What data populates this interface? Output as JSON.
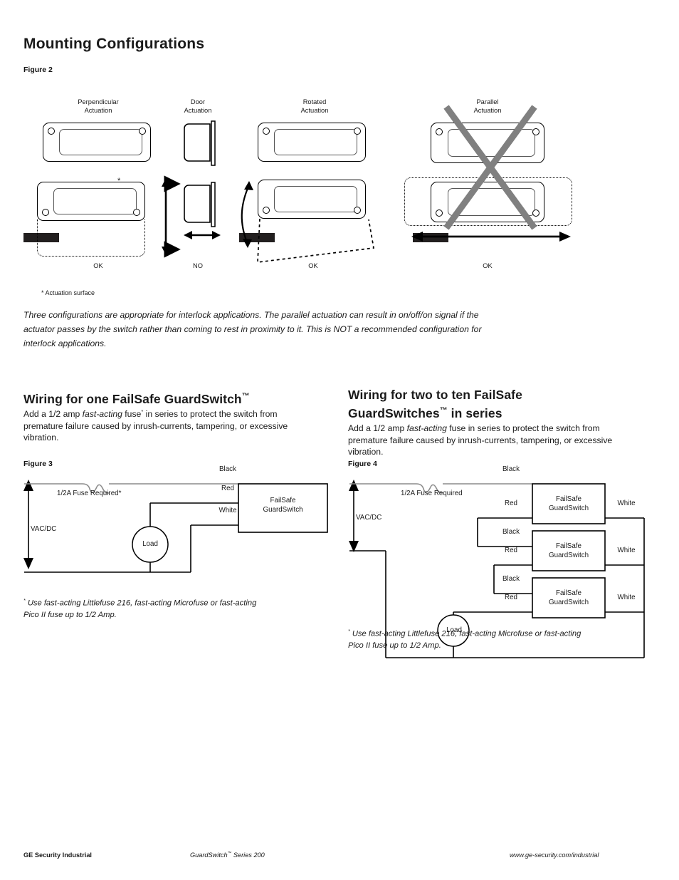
{
  "page": {
    "title": "Mounting Configurations"
  },
  "figure2": {
    "label": "Figure 2",
    "configs": [
      {
        "name": "perpendicular",
        "label": "Perpendicular\nActuation",
        "verdict": "OK"
      },
      {
        "name": "door",
        "label": "Door\nActuation",
        "verdict": "NO"
      },
      {
        "name": "rotated",
        "label": "Rotated\nActuation",
        "verdict": "OK"
      },
      {
        "name": "parallel",
        "label": "Parallel\nActuation",
        "verdict": "OK"
      }
    ],
    "actuation_surface_marker": "*",
    "actuation_surface_note": "* Actuation surface",
    "caption": "Three configurations are appropriate for interlock applications. The parallel actuation can result in on/off/on signal if the actuator passes by the switch rather than coming to rest in proximity to it. This is NOT a recommended configuration for interlock applications.",
    "invalid_marker_color": "#808080"
  },
  "section_one": {
    "heading_main": "Wiring for one FailSafe GuardSwitch",
    "heading_tm": "™",
    "body": "Add a 1/2 amp fast-acting fuse* in series to protect the switch from premature failure caused by inrush-currents, tampering, or excessive vibration.",
    "body_parts": {
      "before_italic": "Add a 1/2 amp ",
      "italic": "fast-acting",
      "after_italic": " fuse",
      "footnote_mark": "*",
      "rest": " in series to protect the switch from premature failure caused by inrush-currents, tampering, or excessive vibration."
    },
    "figure_label": "Figure 3",
    "footnote_mark": "*",
    "footnote": "Use fast-acting Littlefuse 216, fast-acting Microfuse or fast-acting Pico II fuse up to 1/2 Amp."
  },
  "section_two": {
    "heading_line1": "Wiring for two to ten FailSafe",
    "heading_line2_main": "GuardSwitches",
    "heading_tm": "™",
    "heading_line2_rest": " in series",
    "body_parts": {
      "before_italic": "Add a 1/2 amp ",
      "italic": "fast-acting",
      "rest": " fuse in series to protect the switch from premature failure caused by inrush-currents, tampering, or excessive vibration."
    },
    "figure_label": "Figure 4",
    "footnote_mark": "*",
    "footnote": "Use fast-acting Littlefuse 216, fast-acting Microfuse or fast-acting Pico II fuse up to 1/2 Amp."
  },
  "figure3": {
    "supply_label": "VAC/DC",
    "fuse_label": "1/2A Fuse Required*",
    "load_label": "Load",
    "wires": [
      {
        "name": "black",
        "label": "Black"
      },
      {
        "name": "red",
        "label": "Red"
      },
      {
        "name": "white",
        "label": "White"
      }
    ],
    "switch_box_label": "FailSafe\nGuardSwitch"
  },
  "figure4": {
    "supply_label": "VAC/DC",
    "fuse_label": "1/2A Fuse Required",
    "load_label": "Load",
    "switch_box_label": "FailSafe\nGuardSwitch",
    "units": [
      {
        "index": 1,
        "black": "Black",
        "red": "Red",
        "white": "White"
      },
      {
        "index": 2,
        "black": "Black",
        "red": "Red",
        "white": "White"
      },
      {
        "index": 3,
        "black": "Black",
        "red": "Red",
        "white": "White"
      }
    ]
  },
  "footer": {
    "left": "GE Security Industrial",
    "center_main": "GuardSwitch",
    "center_tm": "™",
    "center_rest": " Series 200",
    "right": "www.ge-security.com/industrial"
  }
}
